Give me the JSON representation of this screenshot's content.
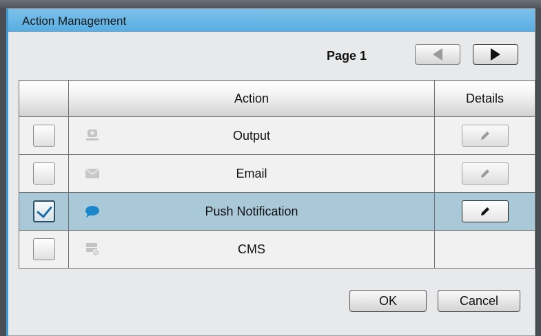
{
  "dialog": {
    "title": "Action Management"
  },
  "pager": {
    "label": "Page 1",
    "prev_icon": "left-triangle-icon",
    "next_icon": "right-triangle-icon"
  },
  "table": {
    "headers": {
      "action": "Action",
      "details": "Details"
    },
    "rows": [
      {
        "name": "Output",
        "icon": "output-icon",
        "checked": false,
        "details": "edit",
        "details_active": false
      },
      {
        "name": "Email",
        "icon": "email-icon",
        "checked": false,
        "details": "edit",
        "details_active": false
      },
      {
        "name": "Push Notification",
        "icon": "chat-bubble-icon",
        "checked": true,
        "details": "edit",
        "details_active": true
      },
      {
        "name": "CMS",
        "icon": "cms-server-icon",
        "checked": false,
        "details": null
      }
    ]
  },
  "footer": {
    "ok_label": "OK",
    "cancel_label": "Cancel"
  },
  "colors": {
    "title_bar": "#5aaee2",
    "selected_row": "#a9c9d8",
    "checkmark": "#1a6fa8",
    "chat_icon": "#1b86c9"
  }
}
